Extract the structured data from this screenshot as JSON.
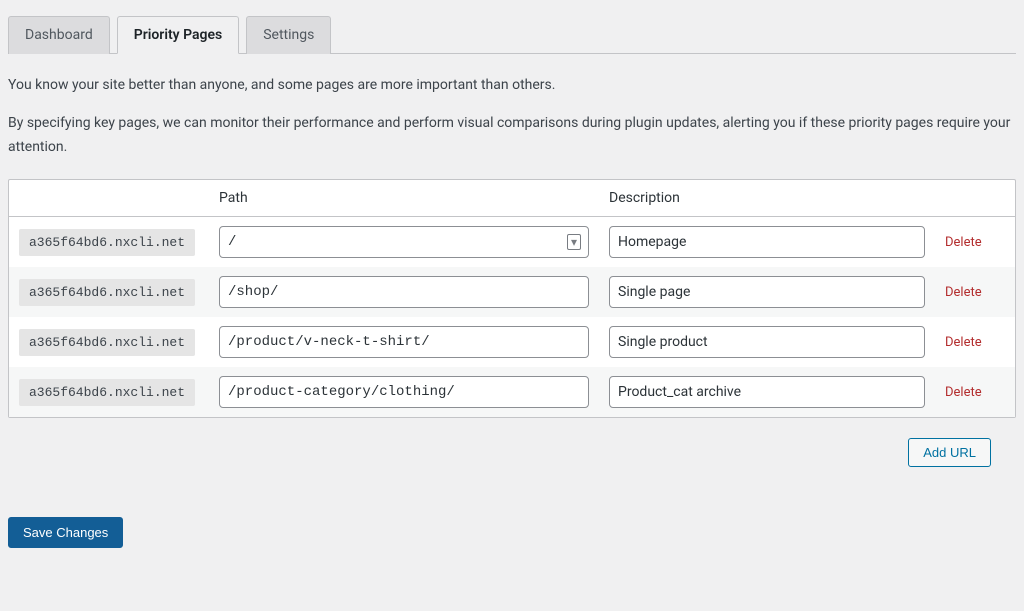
{
  "tabs": {
    "dashboard": "Dashboard",
    "priority": "Priority Pages",
    "settings": "Settings"
  },
  "intro": {
    "p1": "You know your site better than anyone, and some pages are more important than others.",
    "p2": "By specifying key pages, we can monitor their performance and perform visual comparisons during plugin updates, alerting you if these priority pages require your attention."
  },
  "table": {
    "headers": {
      "path": "Path",
      "description": "Description"
    },
    "rows": [
      {
        "domain": "a365f64bd6.nxcli.net",
        "path": "/",
        "desc": "Homepage",
        "delete": "Delete",
        "showIcon": true
      },
      {
        "domain": "a365f64bd6.nxcli.net",
        "path": "/shop/",
        "desc": "Single page",
        "delete": "Delete",
        "showIcon": false
      },
      {
        "domain": "a365f64bd6.nxcli.net",
        "path": "/product/v-neck-t-shirt/",
        "desc": "Single product",
        "delete": "Delete",
        "showIcon": false
      },
      {
        "domain": "a365f64bd6.nxcli.net",
        "path": "/product-category/clothing/",
        "desc": "Product_cat archive",
        "delete": "Delete",
        "showIcon": false
      }
    ]
  },
  "buttons": {
    "addUrl": "Add URL",
    "save": "Save Changes"
  }
}
